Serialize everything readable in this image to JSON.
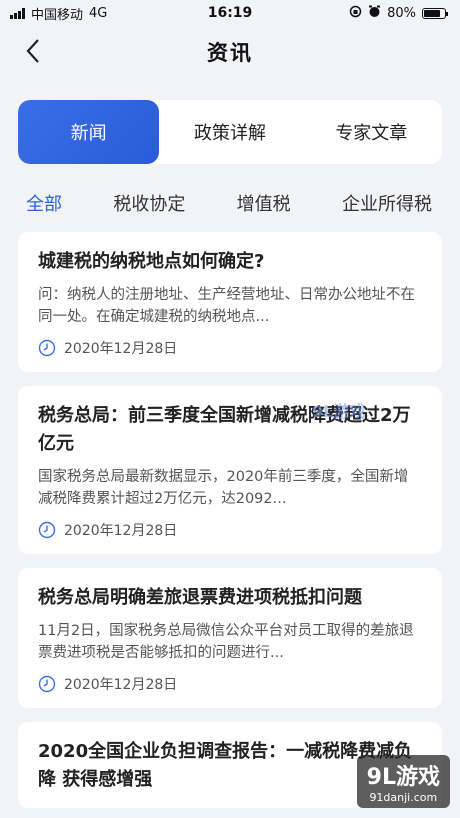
{
  "status": {
    "carrier": "中国移动",
    "network": "4G",
    "time": "16:19",
    "battery_text": "80%",
    "battery_level": 0.8
  },
  "nav": {
    "title": "资讯",
    "back_icon": "chevron-left-icon"
  },
  "top_tabs": [
    {
      "label": "新闻",
      "active": true
    },
    {
      "label": "政策详解",
      "active": false
    },
    {
      "label": "专家文章",
      "active": false
    }
  ],
  "category_tabs": [
    {
      "label": "全部",
      "active": true
    },
    {
      "label": "税收协定",
      "active": false
    },
    {
      "label": "增值税",
      "active": false
    },
    {
      "label": "企业所得税",
      "active": false
    }
  ],
  "articles": [
    {
      "title": "城建税的纳税地点如何确定?",
      "summary": "问：纳税人的注册地址、生产经营地址、日常办公地址不在同一处。在确定城建税的纳税地点...",
      "date": "2020年12月28日"
    },
    {
      "title": "税务总局：前三季度全国新增减税降费超过2万亿元",
      "summary": "国家税务总局最新数据显示，2020年前三季度，全国新增减税降费累计超过2万亿元，达2092...",
      "date": "2020年12月28日"
    },
    {
      "title": "税务总局明确差旅退票费进项税抵扣问题",
      "summary": "11月2日，国家税务总局微信公众平台对员工取得的差旅退票费进项税是否能够抵扣的问题进行...",
      "date": "2020年12月28日"
    },
    {
      "title": "2020全国企业负担调查报告：一减税降费减负降 获得感增强",
      "summary": "",
      "date": ""
    }
  ],
  "watermark": {
    "logo": "9L游戏",
    "url": "91danji.com",
    "ghost": "9L游戏"
  },
  "colors": {
    "accent": "#2a63d8",
    "background": "#f2f3f7"
  }
}
